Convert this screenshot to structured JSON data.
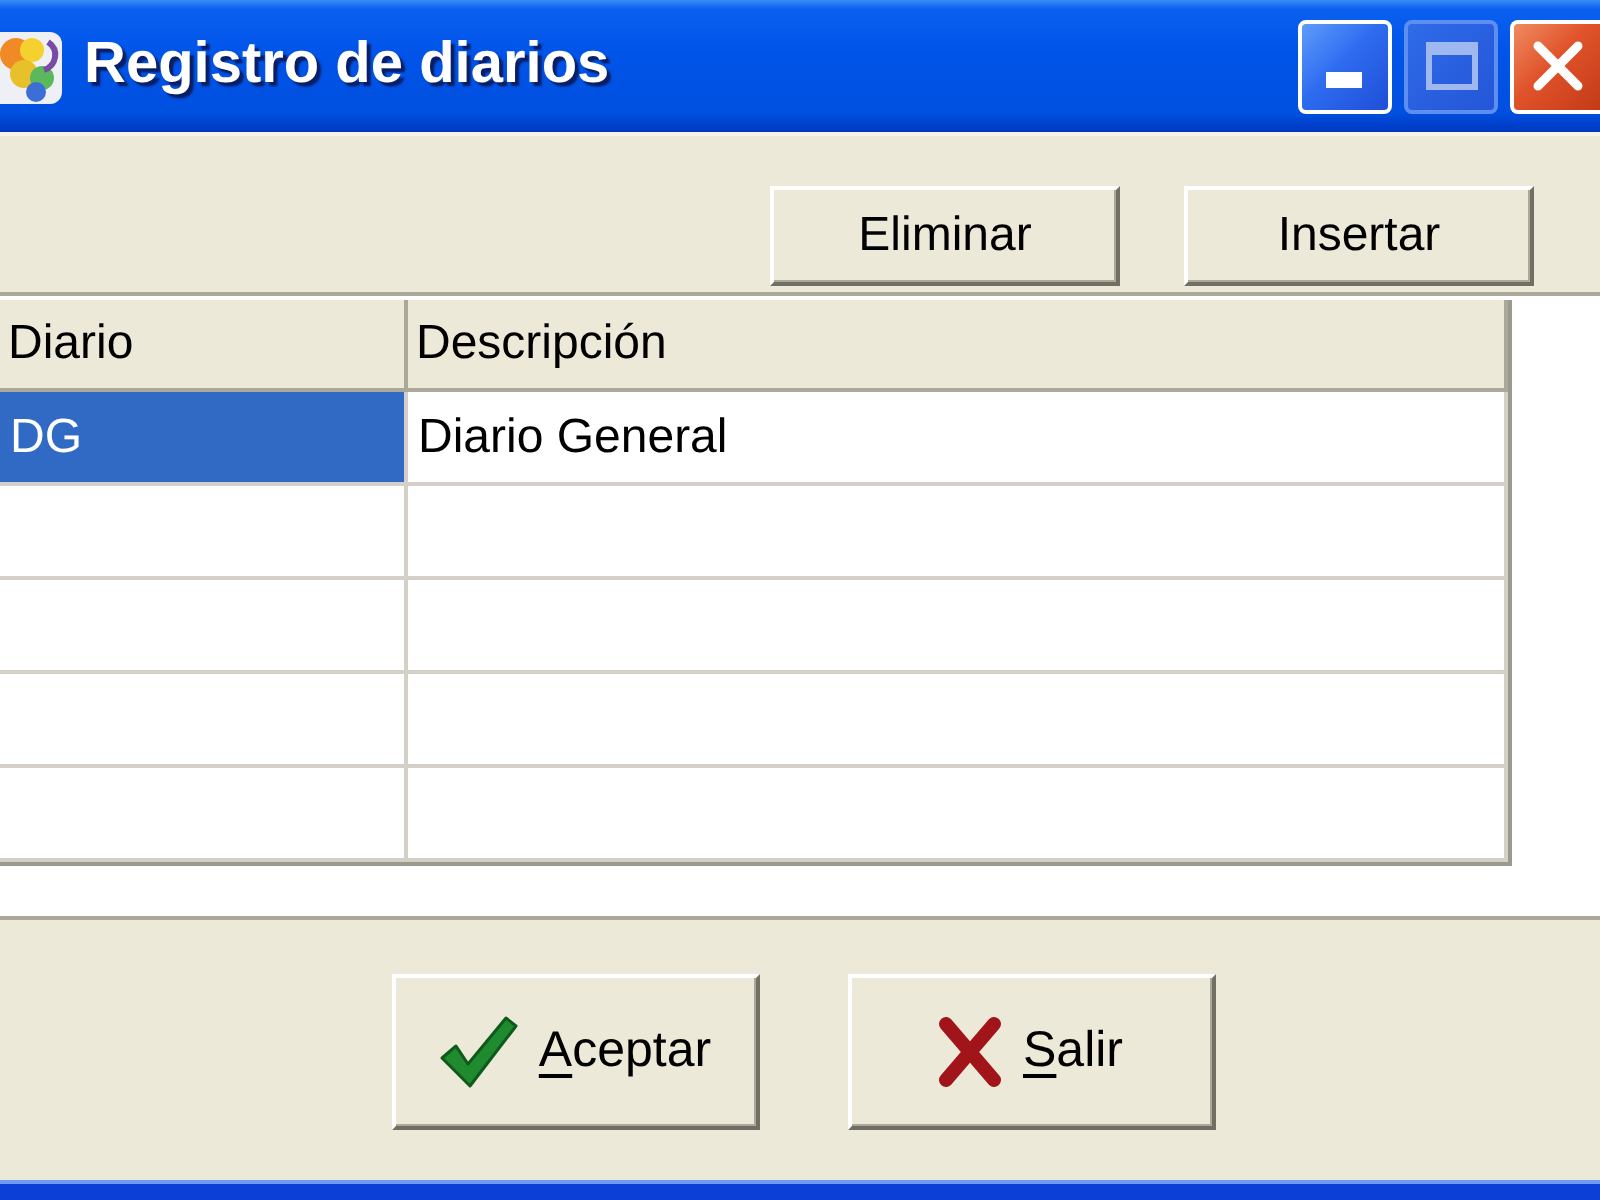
{
  "window": {
    "title": "Registro de diarios",
    "controls": [
      {
        "kind": "minimize",
        "disabled": false
      },
      {
        "kind": "maximize",
        "disabled": true
      },
      {
        "kind": "close",
        "disabled": false
      }
    ]
  },
  "toolbar": {
    "buttons": [
      {
        "label": "Eliminar"
      },
      {
        "label": "Insertar"
      }
    ]
  },
  "table": {
    "columns": [
      "Diario",
      "Descripción"
    ],
    "rows": [
      {
        "cells": [
          "DG",
          "Diario General"
        ],
        "selected": true
      },
      {
        "selected": false
      },
      {
        "selected": false
      },
      {
        "selected": false
      },
      {
        "selected": false
      }
    ]
  },
  "footer_buttons": [
    {
      "kind": "accept",
      "label": "Aceptar",
      "mnemonic": true
    },
    {
      "kind": "cancel",
      "label": "Salir",
      "mnemonic": true
    }
  ]
}
